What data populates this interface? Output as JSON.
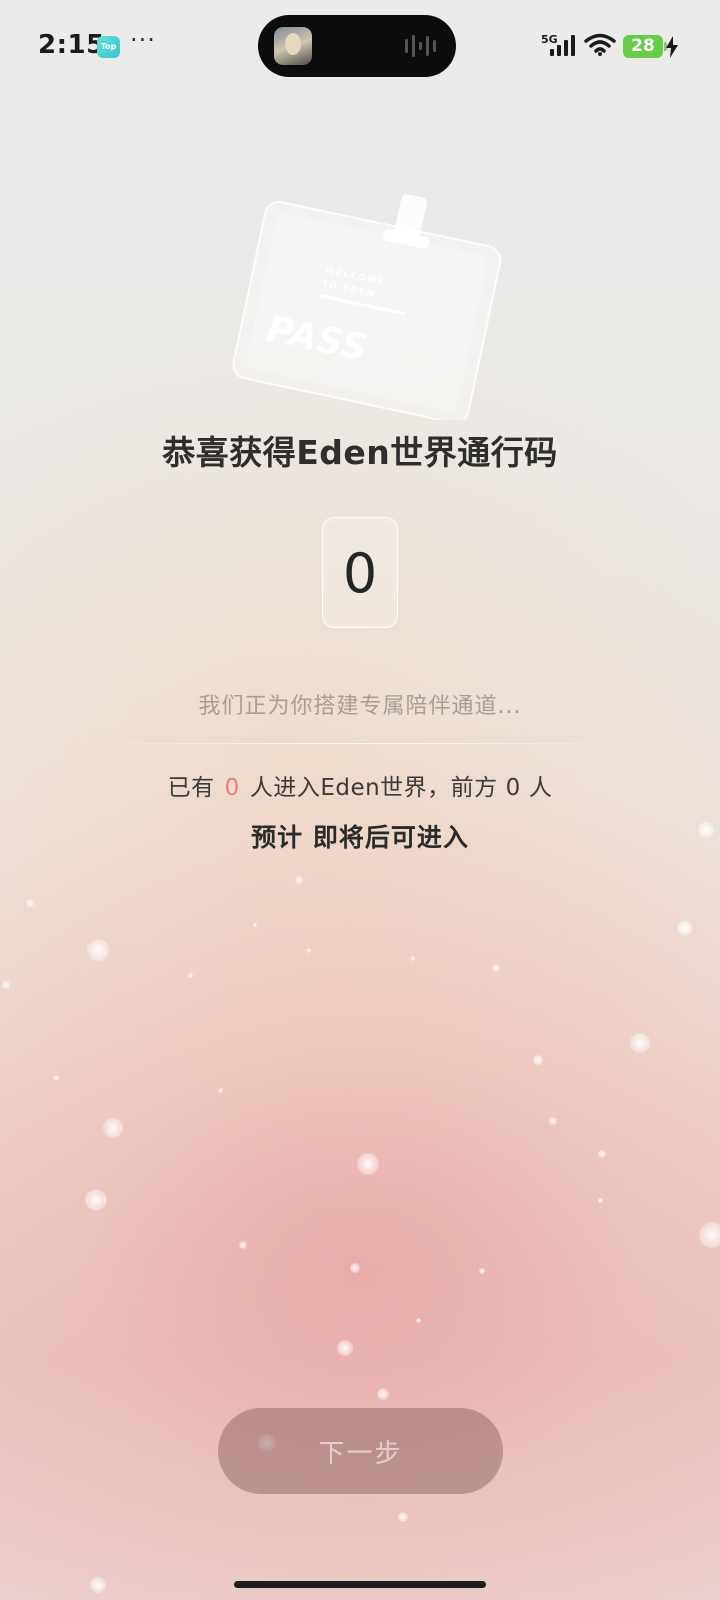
{
  "status_bar": {
    "time": "2:15",
    "app_badge": "Top",
    "more": "···",
    "network": "5G",
    "battery": "28"
  },
  "pass_card": {
    "line1": "WELCOME",
    "line2": "TO EDEN",
    "word": "PASS"
  },
  "main": {
    "headline": "恭喜获得Eden世界通行码",
    "code": "0",
    "building_text": "我们正为你搭建专属陪伴通道...",
    "queue": {
      "prefix": "已有",
      "entered_count": "0",
      "middle": "人进入Eden世界，前方",
      "ahead_count": "0",
      "suffix": "人"
    },
    "eta": "预计 即将后可进入"
  },
  "footer": {
    "next_label": "下一步"
  },
  "colors": {
    "accent_red": "#ec7e78",
    "battery_green": "#68cc4b"
  }
}
